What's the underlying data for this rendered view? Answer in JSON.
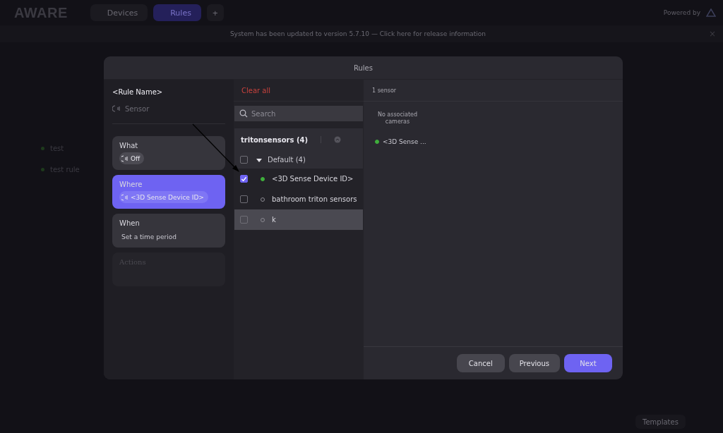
{
  "app_bar": {
    "logo": "AWARE",
    "tabs": [
      {
        "label": "Devices",
        "selected": false
      },
      {
        "label": "Rules",
        "selected": true
      }
    ],
    "add": "+",
    "powered_by": "Powered by"
  },
  "banner": {
    "text": "System has been updated to version 5.7.10 — Click here for release information",
    "close": "×"
  },
  "background_rules": [
    {
      "name": "test"
    },
    {
      "name": "test rule"
    }
  ],
  "templates_button": "Templates",
  "dialog": {
    "title": "Rules",
    "rule_name": "<Rule Name>",
    "rule_type": "Sensor",
    "steps": [
      {
        "kind": "chip",
        "title": "What",
        "text": "Off",
        "selected": false,
        "disabled": false
      },
      {
        "kind": "chip",
        "title": "Where",
        "text": "<3D Sense Device ID>",
        "selected": true,
        "disabled": false
      },
      {
        "kind": "hint",
        "title": "When",
        "text": "Set a time period",
        "selected": false,
        "disabled": false
      },
      {
        "kind": "empty",
        "title": "Actions",
        "selected": false,
        "disabled": true
      }
    ],
    "clear_all": "Clear all",
    "search": {
      "placeholder": "Search"
    },
    "group": {
      "name": "tritonsensors (4)",
      "folders": [
        {
          "name": "Default (4)",
          "checked": false,
          "expanded": true,
          "children": [
            {
              "name": "<3D Sense Device ID>",
              "checked": true,
              "online": true,
              "highlighted": false
            },
            {
              "name": "bathroom triton sensors",
              "checked": false,
              "online": false,
              "highlighted": false
            },
            {
              "name": "k",
              "checked": false,
              "online": false,
              "highlighted": true
            }
          ]
        }
      ]
    },
    "summary": {
      "count": "1 sensor",
      "cameras_note": "No associated cameras",
      "sensors": [
        {
          "name": "<3D Sense ...",
          "online": true
        }
      ]
    },
    "buttons": [
      {
        "label": "Cancel",
        "kind": "secondary"
      },
      {
        "label": "Previous",
        "kind": "secondary"
      },
      {
        "label": "Next",
        "kind": "primary"
      }
    ]
  }
}
